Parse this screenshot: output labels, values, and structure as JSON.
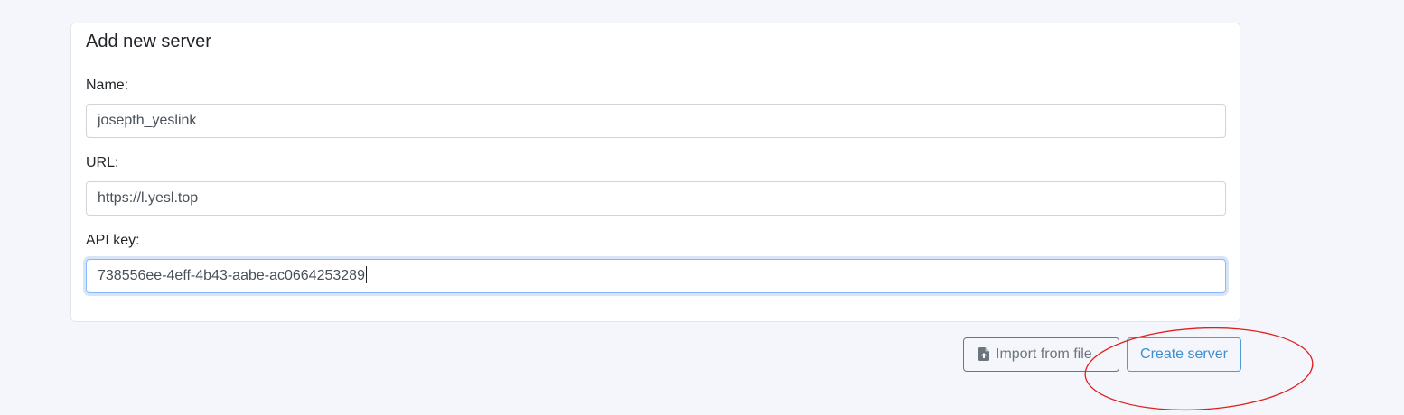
{
  "form": {
    "title": "Add new server",
    "name_label": "Name:",
    "name_value": "josepth_yeslink",
    "url_label": "URL:",
    "url_value": "https://l.yesl.top",
    "api_key_label": "API key:",
    "api_key_value": "738556ee-4eff-4b43-aabe-ac0664253289"
  },
  "actions": {
    "import_label": "Import from file",
    "create_label": "Create server",
    "import_icon": "file-upload-icon"
  },
  "colors": {
    "page_background": "#f5f6fc",
    "primary_outline": "#4f9bd7",
    "secondary_outline": "#6c757d",
    "annotation_circle": "#e0201c"
  }
}
